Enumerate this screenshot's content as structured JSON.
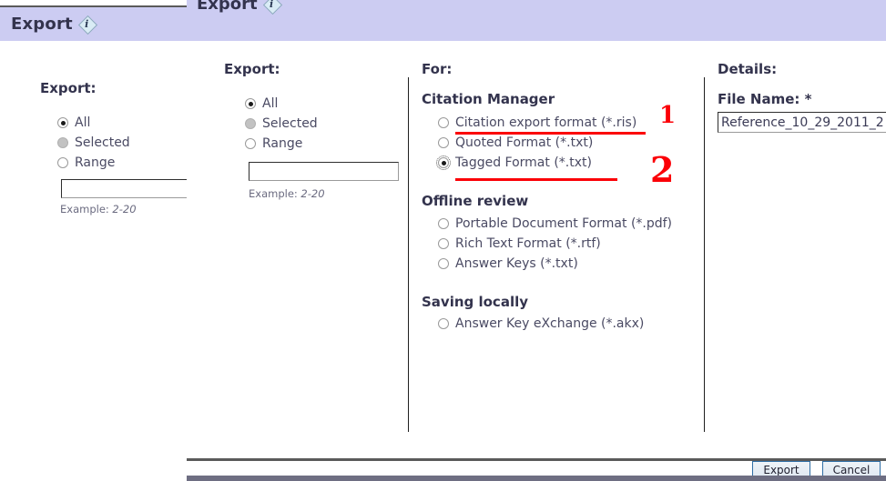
{
  "background_dialog": {
    "title": "Export",
    "help_icon_letter": "i",
    "section_label": "Export:",
    "options": [
      {
        "label": "All",
        "state": "checked"
      },
      {
        "label": "Selected",
        "state": "disabled"
      },
      {
        "label": "Range",
        "state": "unchecked"
      }
    ],
    "range_value": "",
    "example_prefix": "Example: ",
    "example_value": "2-20"
  },
  "foreground_dialog": {
    "title": "Export",
    "help_icon_letter": "i",
    "export_column": {
      "heading": "Export:",
      "options": [
        {
          "label": "All",
          "state": "checked"
        },
        {
          "label": "Selected",
          "state": "disabled"
        },
        {
          "label": "Range",
          "state": "unchecked"
        }
      ],
      "range_value": "",
      "example_prefix": "Example: ",
      "example_value": "2-20"
    },
    "for_column": {
      "heading": "For:",
      "groups": [
        {
          "title": "Citation Manager",
          "options": [
            {
              "label": "Citation export format (*.ris)",
              "state": "unchecked"
            },
            {
              "label": "Quoted Format (*.txt)",
              "state": "unchecked"
            },
            {
              "label": "Tagged Format (*.txt)",
              "state": "checked"
            }
          ]
        },
        {
          "title": "Offline review",
          "options": [
            {
              "label": "Portable Document Format (*.pdf)",
              "state": "unchecked"
            },
            {
              "label": "Rich Text Format (*.rtf)",
              "state": "unchecked"
            },
            {
              "label": "Answer Keys (*.txt)",
              "state": "unchecked"
            }
          ]
        },
        {
          "title": "Saving locally",
          "options": [
            {
              "label": "Answer Key eXchange (*.akx)",
              "state": "unchecked"
            }
          ]
        }
      ]
    },
    "details_column": {
      "heading": "Details:",
      "file_name_label": "File Name: *",
      "file_name_value": "Reference_10_29_2011_2"
    },
    "buttons": [
      {
        "label": "Export"
      },
      {
        "label": "Cancel"
      }
    ]
  },
  "annotations": {
    "color": "#fb0007",
    "marks": [
      {
        "text": "1",
        "target": "Citation export format (*.ris)"
      },
      {
        "text": "2",
        "target": "Tagged Format (*.txt)"
      }
    ]
  }
}
